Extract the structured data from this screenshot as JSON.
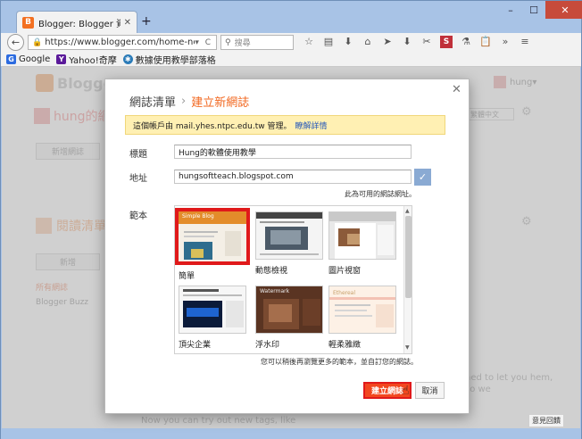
{
  "browser": {
    "tab_title": "Blogger: Blogger 資訊主頁",
    "tab_icon": "B",
    "new_tab": "+",
    "url": "https://www.blogger.com/home-new.g",
    "search_placeholder": "搜尋",
    "bookmarks": [
      {
        "label": "Google",
        "icon": "G",
        "color": "#2c6be0"
      },
      {
        "label": "Yahoo!奇摩",
        "icon": "Y",
        "color": "#5b1a9a"
      },
      {
        "label": "數據使用教學部落格",
        "icon": "✱",
        "color": "#2b7bb8"
      }
    ]
  },
  "background": {
    "logo": "Blogger",
    "user": "hung",
    "blog_title": "hung的網",
    "new_post": "新增網誌",
    "lang": "繁體中文",
    "reading_list": "閱讀清單",
    "add": "新增",
    "all_blogs": "所有網誌",
    "blogger_buzz": "Blogger Buzz",
    "side_text": "ned to let you hem, so we",
    "bottom_text": "Now you can try out new tags, like",
    "feedback": "意見回饋"
  },
  "dialog": {
    "breadcrumb_root": "網誌清單",
    "breadcrumb_separator": "›",
    "breadcrumb_current": "建立新網誌",
    "notice_text": "這個帳戶由 mail.yhes.ntpc.edu.tw 管理。",
    "notice_link": "瞭解詳情",
    "title_label": "標題",
    "title_value": "Hung的軟體使用教學",
    "address_label": "地址",
    "address_value": "hungsoftteach.blogspot.com",
    "address_hint": "此為可用的網誌網址。",
    "template_label": "範本",
    "templates": [
      {
        "name": "簡單",
        "selected": true
      },
      {
        "name": "動態檢視",
        "selected": false
      },
      {
        "name": "圖片視窗",
        "selected": false
      },
      {
        "name": "頂尖企業",
        "selected": false
      },
      {
        "name": "浮水印",
        "selected": false
      },
      {
        "name": "輕柔雅緻",
        "selected": false
      }
    ],
    "template_preview_titles": [
      "Simple Blog",
      "Watermark",
      "Ethereal"
    ],
    "help_text": "您可以稍後再瀏覽更多的範本，並自訂您的網誌。",
    "create_button": "建立網誌",
    "cancel_button": "取消"
  },
  "colors": {
    "accent": "#f2671f",
    "selection": "#e0191a",
    "notice_bg": "#fff0b3",
    "link": "#2659b9"
  }
}
